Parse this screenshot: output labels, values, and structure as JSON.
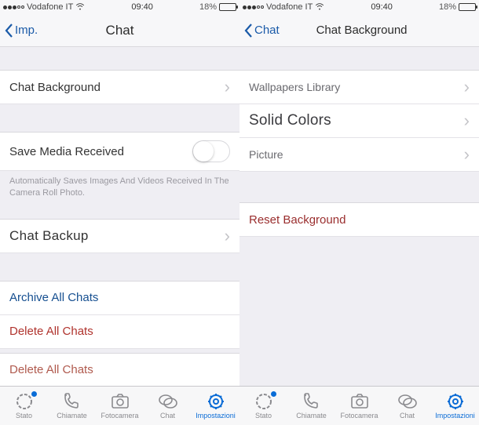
{
  "status": {
    "carrier": "Vodafone IT",
    "time": "09:40",
    "battery_pct": "18%"
  },
  "left_screen": {
    "nav": {
      "back_label": "Imp.",
      "title": "Chat"
    },
    "rows": {
      "chat_background": "Chat Background",
      "save_media": "Save Media Received",
      "save_media_note": "Automatically Saves Images And Videos Received In The Camera Roll Photo.",
      "chat_backup": "Chat Backup",
      "archive_all": "Archive All Chats",
      "delete_all_1": "Delete All Chats",
      "delete_all_2": "Delete All Chats"
    }
  },
  "right_screen": {
    "nav": {
      "back_label": "Chat",
      "title": "Chat Background"
    },
    "rows": {
      "wallpapers": "Wallpapers Library",
      "solid_colors": "Solid Colors",
      "picture": "Picture",
      "reset": "Reset Background"
    }
  },
  "tabs": {
    "stato": "Stato",
    "chiamate": "Chiamate",
    "fotocamera": "Fotocamera",
    "chat": "Chat",
    "impostazioni": "Impostazioni"
  },
  "colors": {
    "accent": "#0a6cd6",
    "battery_fill": "#f9c43a"
  }
}
